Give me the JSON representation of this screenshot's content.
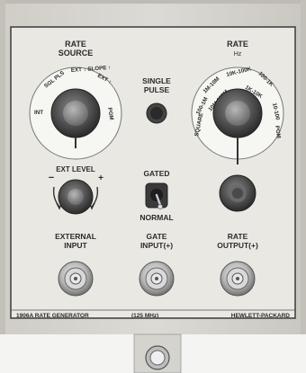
{
  "panel": {
    "rate_source": {
      "title_line1": "RATE",
      "title_line2": "SOURCE",
      "positions": [
        "INT",
        "SGL PLS",
        "EXT ↓ SLOPE ↑",
        "EXT ↑",
        "PGM"
      ]
    },
    "single_pulse": {
      "line1": "SINGLE",
      "line2": "PULSE"
    },
    "rate": {
      "title": "RATE",
      "unit": "Hz",
      "positions": [
        "SQUARE",
        "100-1M",
        "1M-10M",
        "10M-125M",
        "10K-100K",
        "1K-10K",
        "100-1K",
        "10-100",
        "PGM"
      ]
    },
    "ext_level": {
      "label": "EXT LEVEL",
      "minus": "−",
      "plus": "+"
    },
    "gated_switch": {
      "top_label": "GATED",
      "bottom_label": "NORMAL"
    },
    "external_input": {
      "line1": "EXTERNAL",
      "line2": "INPUT"
    },
    "gate_input": {
      "line1": "GATE",
      "line2": "INPUT(+)"
    },
    "rate_output": {
      "line1": "RATE",
      "line2": "OUTPUT(+)"
    },
    "footer": {
      "model": "1906A RATE GENERATOR",
      "frequency": "(125 MHz)",
      "brand": "HEWLETT-PACKARD"
    }
  },
  "colors": {
    "panel": "#e9e8e3",
    "frame": "#d6d4ce",
    "ink": "#2b2b2b",
    "knob": "#3a3a3a"
  }
}
